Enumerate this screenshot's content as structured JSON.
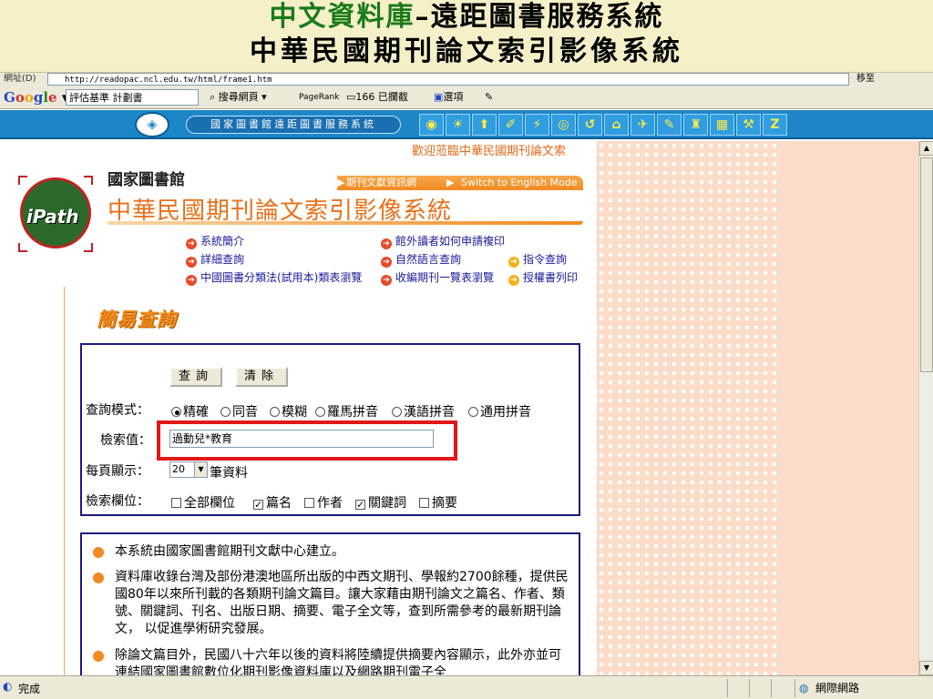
{
  "slide": {
    "title_line1_a": "中文資料庫",
    "title_line1_b": "–遠距圖書服務系統",
    "title_line2": "中華民國期刊論文索引影像系統"
  },
  "browser": {
    "address_label": "網址(D)",
    "url": "http://readopac.ncl.edu.tw/html/frame1.htm",
    "go_label": "移至",
    "google_logo": "Google",
    "google_search_value": "評估基準 計劃書",
    "search_web_label": "搜尋網頁",
    "pagerank_label": "PageRank",
    "blocked_label": "166 已攔截",
    "options_label": "選項",
    "status_text": "完成",
    "zone_text": "網際網路"
  },
  "ncl_nav": {
    "pill_label": "國家圖書館遠距圖書服務系統",
    "icons": [
      "◉",
      "☀",
      "⬆",
      "✐",
      "⚡",
      "◎",
      "↺",
      "⌂",
      "✈",
      "✎",
      "♜",
      "▦",
      "⚒",
      "Z"
    ]
  },
  "page": {
    "welcome": "歡迎蒞臨中華民國期刊論文索",
    "ncl_name": "國家圖書館",
    "band_link1": "期刊文獻資訊網",
    "band_link2": "Switch to English Mode",
    "system_title": "中華民國期刊論文索引影像系統",
    "logo_text": "iPath",
    "menu": {
      "intro": "系統簡介",
      "detail": "詳細查詢",
      "classify": "中國圖書分類法(試用本)類表瀏覽",
      "copy": "館外讀者如何申請複印",
      "natural": "自然語言查詢",
      "collection": "收編期刊一覽表瀏覽",
      "command": "指令查詢",
      "license": "授權書列印"
    },
    "simple_query_title": "簡易查詢"
  },
  "search_form": {
    "query_btn": "查詢",
    "clear_btn": "清除",
    "mode_label": "查詢模式：",
    "modes": [
      "精確",
      "同音",
      "模糊",
      "羅馬拼音",
      "漢語拼音",
      "通用拼音"
    ],
    "mode_selected": "精確",
    "term_label": "檢索值：",
    "term_value": "過動兒*教育",
    "perpage_label": "每頁顯示：",
    "perpage_value": "20",
    "perpage_unit": "筆資料",
    "field_label": "檢索欄位：",
    "fields": [
      {
        "label": "全部欄位",
        "checked": false
      },
      {
        "label": "篇名",
        "checked": true
      },
      {
        "label": "作者",
        "checked": false
      },
      {
        "label": "關鍵詞",
        "checked": true
      },
      {
        "label": "摘要",
        "checked": false
      }
    ]
  },
  "info": {
    "item1": "本系統由國家圖書館期刊文獻中心建立。",
    "item2": "資料庫收錄台灣及部份港澳地區所出版的中西文期刊、學報約2700餘種，提供民國80年以來所刊載的各類期刊論文篇目。讓大家藉由期刊論文之篇名、作者、類號、關鍵詞、刊名、出版日期、摘要、電子全文等，查到所需參考的最新期刊論文， 以促進學術研究發展。",
    "item3": "除論文篇目外，民國八十六年以後的資料將陸續提供摘要內容顯示，此外亦並可連結國家圖書館數位化期刊影像資料庫以及網路期刊電子全"
  },
  "colors": {
    "accent_orange": "#f28a21",
    "nav_blue": "#1c86c7",
    "highlight_red": "#e01818",
    "link_blue": "#1a1a9a"
  }
}
